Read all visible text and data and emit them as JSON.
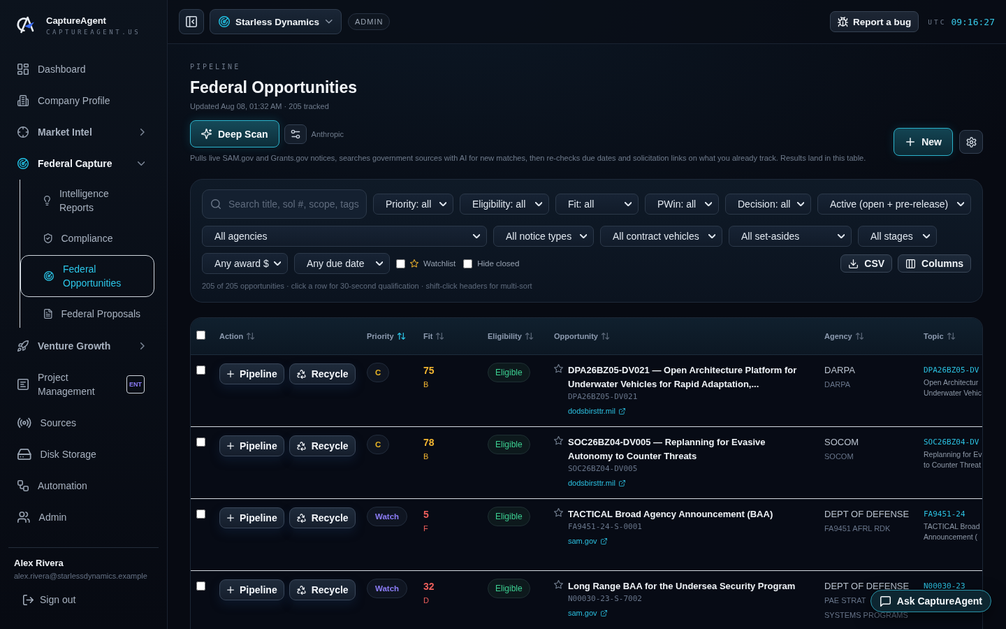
{
  "brand": {
    "name": "CaptureAgent",
    "domain": "CAPTUREAGENT.US"
  },
  "sidebar": {
    "items": [
      {
        "label": "Dashboard",
        "kind": "link",
        "selected": false
      },
      {
        "label": "Company Profile",
        "kind": "link",
        "selected": false
      },
      {
        "label": "Market Intel",
        "kind": "group",
        "expanded": false
      },
      {
        "label": "Federal Capture",
        "kind": "group",
        "expanded": true,
        "children": [
          {
            "label": "Intelligence Reports",
            "selected": false
          },
          {
            "label": "Compliance",
            "selected": false
          },
          {
            "label": "Federal Opportunities",
            "selected": true
          },
          {
            "label": "Federal Proposals",
            "selected": false
          }
        ]
      },
      {
        "label": "Venture Growth",
        "kind": "group",
        "expanded": false
      },
      {
        "label": "Project Management",
        "kind": "link",
        "selected": false,
        "badge": "ENT"
      },
      {
        "label": "Sources",
        "kind": "link",
        "selected": false
      },
      {
        "label": "Disk Storage",
        "kind": "link",
        "selected": false
      },
      {
        "label": "Automation",
        "kind": "link",
        "selected": false
      },
      {
        "label": "Admin",
        "kind": "link",
        "selected": false
      }
    ],
    "user": {
      "name": "Alex Rivera",
      "email": "alex.rivera@starlessdynamics.example"
    },
    "sign_out": "Sign out"
  },
  "topbar": {
    "workspace": "Starless Dynamics",
    "role": "ADMIN",
    "report_bug": "Report a bug",
    "timezone": "UTC",
    "time": "09:16:27"
  },
  "header": {
    "eyebrow": "PIPELINE",
    "title": "Federal Opportunities",
    "updated": "Updated Aug 08, 01:32 AM · 205 tracked",
    "deep_scan": "Deep Scan",
    "model": "Anthropic",
    "new_button": "New",
    "description": "Pulls live SAM.gov and Grants.gov notices, searches government sources with AI for new matches, then re-checks due dates and solicitation links on what you already track. Results land in this table."
  },
  "filters": {
    "search": {
      "placeholder": "Search title, sol #, scope, tags"
    },
    "rows": [
      {
        "dropdowns": [
          "Priority: all",
          "Eligibility: all",
          "Fit: all",
          "PWin: all",
          "Decision: all",
          "Active (open + pre-release)"
        ]
      },
      {
        "dropdowns": [
          "All agencies",
          "All notice types",
          "All contract vehicles",
          "All set-asides",
          "All stages"
        ]
      },
      {
        "dropdowns": [
          "Any award $",
          "Any due date"
        ]
      }
    ],
    "checkboxes": [
      {
        "label": "Watchlist",
        "kind": "starred",
        "checked": false
      },
      {
        "label": "Hide closed",
        "kind": "plain",
        "checked": false
      }
    ],
    "buttons": [
      "CSV",
      "Columns"
    ],
    "summary": "205 of 205 opportunities · click a row for 30-second qualification · shift-click headers for multi-sort"
  },
  "table": {
    "select_all": {
      "checked": false
    },
    "columns": [
      {
        "label": "Action",
        "sorted": false
      },
      {
        "label": "Priority",
        "sorted": true
      },
      {
        "label": "Fit",
        "sorted": false
      },
      {
        "label": "Eligibility",
        "sorted": false
      },
      {
        "label": "Opportunity",
        "sorted": false
      },
      {
        "label": "Agency",
        "sorted": false
      },
      {
        "label": "Topic",
        "sorted": false
      }
    ],
    "rows": [
      {
        "selected": false,
        "actions": [
          "Pipeline",
          "Recycle"
        ],
        "priority": {
          "label": "C",
          "color": "#e6b325"
        },
        "fit": {
          "score": "75",
          "grade": "B",
          "color": "#f4b731"
        },
        "eligibility": "Eligible",
        "starred": false,
        "title": "DPA26BZ05-DV021 — Open Architecture Platform for Underwater Vehicles for Rapid Adaptation,...",
        "solicitation": "DPA26BZ05-DV021",
        "link": "dodsbirsttr.mil",
        "agency": "DARPA",
        "agency_office_lines": [
          "DARPA"
        ],
        "topic_code": "DPA26BZ05-DV",
        "topic_lines": [
          "Open Architectur",
          "Underwater Vehic"
        ]
      },
      {
        "selected": false,
        "actions": [
          "Pipeline",
          "Recycle"
        ],
        "priority": {
          "label": "C",
          "color": "#e6b325"
        },
        "fit": {
          "score": "78",
          "grade": "B",
          "color": "#f4b731"
        },
        "eligibility": "Eligible",
        "starred": false,
        "title": "SOC26BZ04-DV005 — Replanning for Evasive Autonomy to Counter Threats",
        "solicitation": "SOC26BZ04-DV005",
        "link": "dodsbirsttr.mil",
        "agency": "SOCOM",
        "agency_office_lines": [
          "SOCOM"
        ],
        "topic_code": "SOC26BZ04-DV",
        "topic_lines": [
          "Replanning for Ev",
          "to Counter Threat"
        ]
      },
      {
        "selected": false,
        "actions": [
          "Pipeline",
          "Recycle"
        ],
        "priority": {
          "label": "Watch",
          "color": "#8b7cf6"
        },
        "fit": {
          "score": "5",
          "grade": "F",
          "color": "#ef5f5c"
        },
        "eligibility": "Eligible",
        "starred": false,
        "title": "TACTICAL Broad Agency Announcement (BAA)",
        "solicitation": "FA9451-24-S-0001",
        "link": "sam.gov",
        "agency": "DEPT OF DEFENSE",
        "agency_office_lines": [
          "FA9451 AFRL RDK"
        ],
        "topic_code": "FA9451-24",
        "topic_lines": [
          "TACTICAL Broad",
          "Announcement ("
        ]
      },
      {
        "selected": false,
        "actions": [
          "Pipeline",
          "Recycle"
        ],
        "priority": {
          "label": "Watch",
          "color": "#8b7cf6"
        },
        "fit": {
          "score": "32",
          "grade": "D",
          "color": "#ef5f5c"
        },
        "eligibility": "Eligible",
        "starred": false,
        "title": "Long Range BAA for the Undersea Security Program",
        "solicitation": "N00030-23-S-7002",
        "link": "sam.gov",
        "agency": "DEPT OF DEFENSE",
        "agency_office_lines": [
          "PAE STRAT",
          "SYSTEMS PROGRAMS"
        ],
        "topic_code": "N00030-23"
      }
    ]
  },
  "assistant": {
    "label": "Ask CaptureAgent"
  }
}
